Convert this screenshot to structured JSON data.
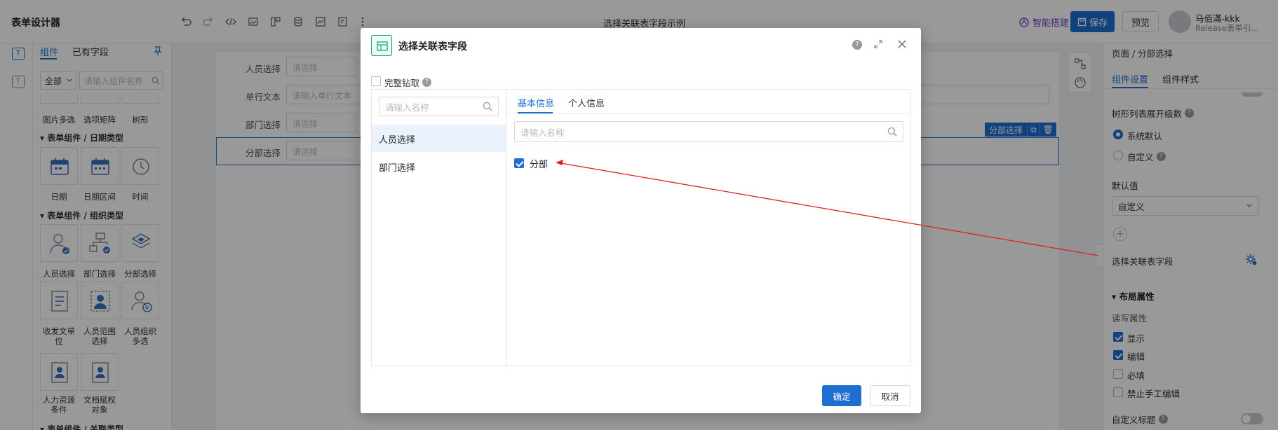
{
  "app": {
    "title": "表单设计器",
    "doc_title": "选择关联表字段示例",
    "smart_build": "智能搭建",
    "save": "保存",
    "preview": "预览",
    "user_name": "马佰滿-kkk",
    "user_sub": "Release表单引..."
  },
  "left_panel": {
    "tab_components": "组件",
    "tab_fields": "已有字段",
    "filter_select": "全部",
    "search_placeholder": "请输入组件名称",
    "row_top": [
      "图片多选",
      "选项矩阵",
      "树形"
    ],
    "section_date": "表单组件 / 日期类型",
    "date_items": [
      "日期",
      "日期区间",
      "时间"
    ],
    "section_org": "表单组件 / 组织类型",
    "org_row1": [
      "人员选择",
      "部门选择",
      "分部选择"
    ],
    "org_row2_a": "收发文单",
    "org_row2_a2": "位",
    "org_row2_b": "人员范围",
    "org_row2_b2": "选择",
    "org_row2_c": "人员组织",
    "org_row2_c2": "多选",
    "org_row3_a": "人力资源",
    "org_row3_a2": "条件",
    "org_row3_b": "文档赋权",
    "org_row3_b2": "对象",
    "section_cut": "表单组件 / 关联类型"
  },
  "canvas": {
    "fields": [
      {
        "label": "人员选择",
        "placeholder": "请选择"
      },
      {
        "label": "单行文本",
        "placeholder": "请输入单行文本"
      },
      {
        "label": "部门选择",
        "placeholder": "请选择"
      },
      {
        "label": "分部选择",
        "placeholder": "请选择"
      }
    ],
    "selected_tag": "分部选择"
  },
  "right_panel": {
    "breadcrumb": "页面 / 分部选择",
    "tab_settings": "组件设置",
    "tab_style": "组件样式",
    "tree_level_label": "树形列表展开级数",
    "radio_default": "系统默认",
    "radio_custom": "自定义",
    "default_value_label": "默认值",
    "default_value_select": "自定义",
    "link_field_label": "选择关联表字段",
    "layout_section": "布局属性",
    "rw_label": "读写属性",
    "cb_show": "显示",
    "cb_edit": "编辑",
    "cb_required": "必填",
    "cb_manual": "禁止手工编辑",
    "custom_title": "自定义标题"
  },
  "modal": {
    "title": "选择关联表字段",
    "drill_label": "完整钻取",
    "left_search_placeholder": "请输入名称",
    "left_items": [
      "人员选择",
      "部门选择"
    ],
    "tabs": [
      "基本信息",
      "个人信息"
    ],
    "right_search_placeholder": "请输入名称",
    "field_item": "分部",
    "confirm": "确定",
    "cancel": "取消"
  },
  "colors": {
    "primary": "#1f6fd0",
    "annotation_red": "#e02020",
    "selected_bg": "#eaf2fd"
  }
}
